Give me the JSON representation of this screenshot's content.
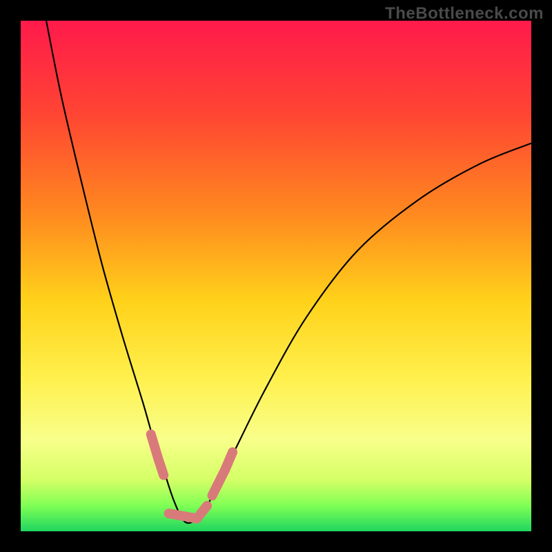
{
  "watermark": "TheBottleneck.com",
  "chart_data": {
    "type": "line",
    "title": "",
    "xlabel": "",
    "ylabel": "",
    "xlim": [
      0,
      100
    ],
    "ylim": [
      0,
      100
    ],
    "grid": false,
    "legend": false,
    "background": {
      "description": "vertical gradient red→orange→yellow→pale-yellow→green representing bottleneck severity (top=bad, bottom=good)",
      "stops": [
        {
          "offset": 0.0,
          "color": "#ff1a4b"
        },
        {
          "offset": 0.18,
          "color": "#ff4433"
        },
        {
          "offset": 0.38,
          "color": "#ff8a1f"
        },
        {
          "offset": 0.55,
          "color": "#ffd21a"
        },
        {
          "offset": 0.7,
          "color": "#fff04d"
        },
        {
          "offset": 0.82,
          "color": "#f8ff8a"
        },
        {
          "offset": 0.9,
          "color": "#d4ff66"
        },
        {
          "offset": 0.95,
          "color": "#7fff55"
        },
        {
          "offset": 1.0,
          "color": "#1fd65f"
        }
      ]
    },
    "series": [
      {
        "name": "bottleneck-curve",
        "description": "V-shaped curve; y is read as height above bottom (0=bottom, 100=top). Minimum ~x=32.",
        "x": [
          5,
          8,
          12,
          16,
          20,
          24,
          26,
          28,
          30,
          32,
          34,
          36,
          38,
          42,
          48,
          56,
          66,
          78,
          90,
          100
        ],
        "y": [
          100,
          85,
          68,
          52,
          38,
          25,
          18,
          12,
          6,
          2,
          2,
          4,
          8,
          16,
          28,
          42,
          55,
          65,
          72,
          76
        ]
      }
    ],
    "highlight": {
      "name": "optimal-zone-markers",
      "description": "fat pink segments along the curve near its minimum marking the low-bottleneck zone",
      "color": "#d97a7a",
      "segments": [
        {
          "x": [
            25.5,
            27.0
          ],
          "y": [
            19,
            14
          ]
        },
        {
          "x": [
            27.0,
            28.0
          ],
          "y": [
            14,
            11
          ]
        },
        {
          "x": [
            29.0,
            34.5
          ],
          "y": [
            3.5,
            2.5
          ]
        },
        {
          "x": [
            34.5,
            36.5
          ],
          "y": [
            2.5,
            5
          ]
        },
        {
          "x": [
            37.5,
            38.5
          ],
          "y": [
            7,
            9
          ]
        },
        {
          "x": [
            38.5,
            40.0
          ],
          "y": [
            9,
            12
          ]
        },
        {
          "x": [
            40.0,
            41.5
          ],
          "y": [
            12,
            15.5
          ]
        }
      ]
    }
  }
}
